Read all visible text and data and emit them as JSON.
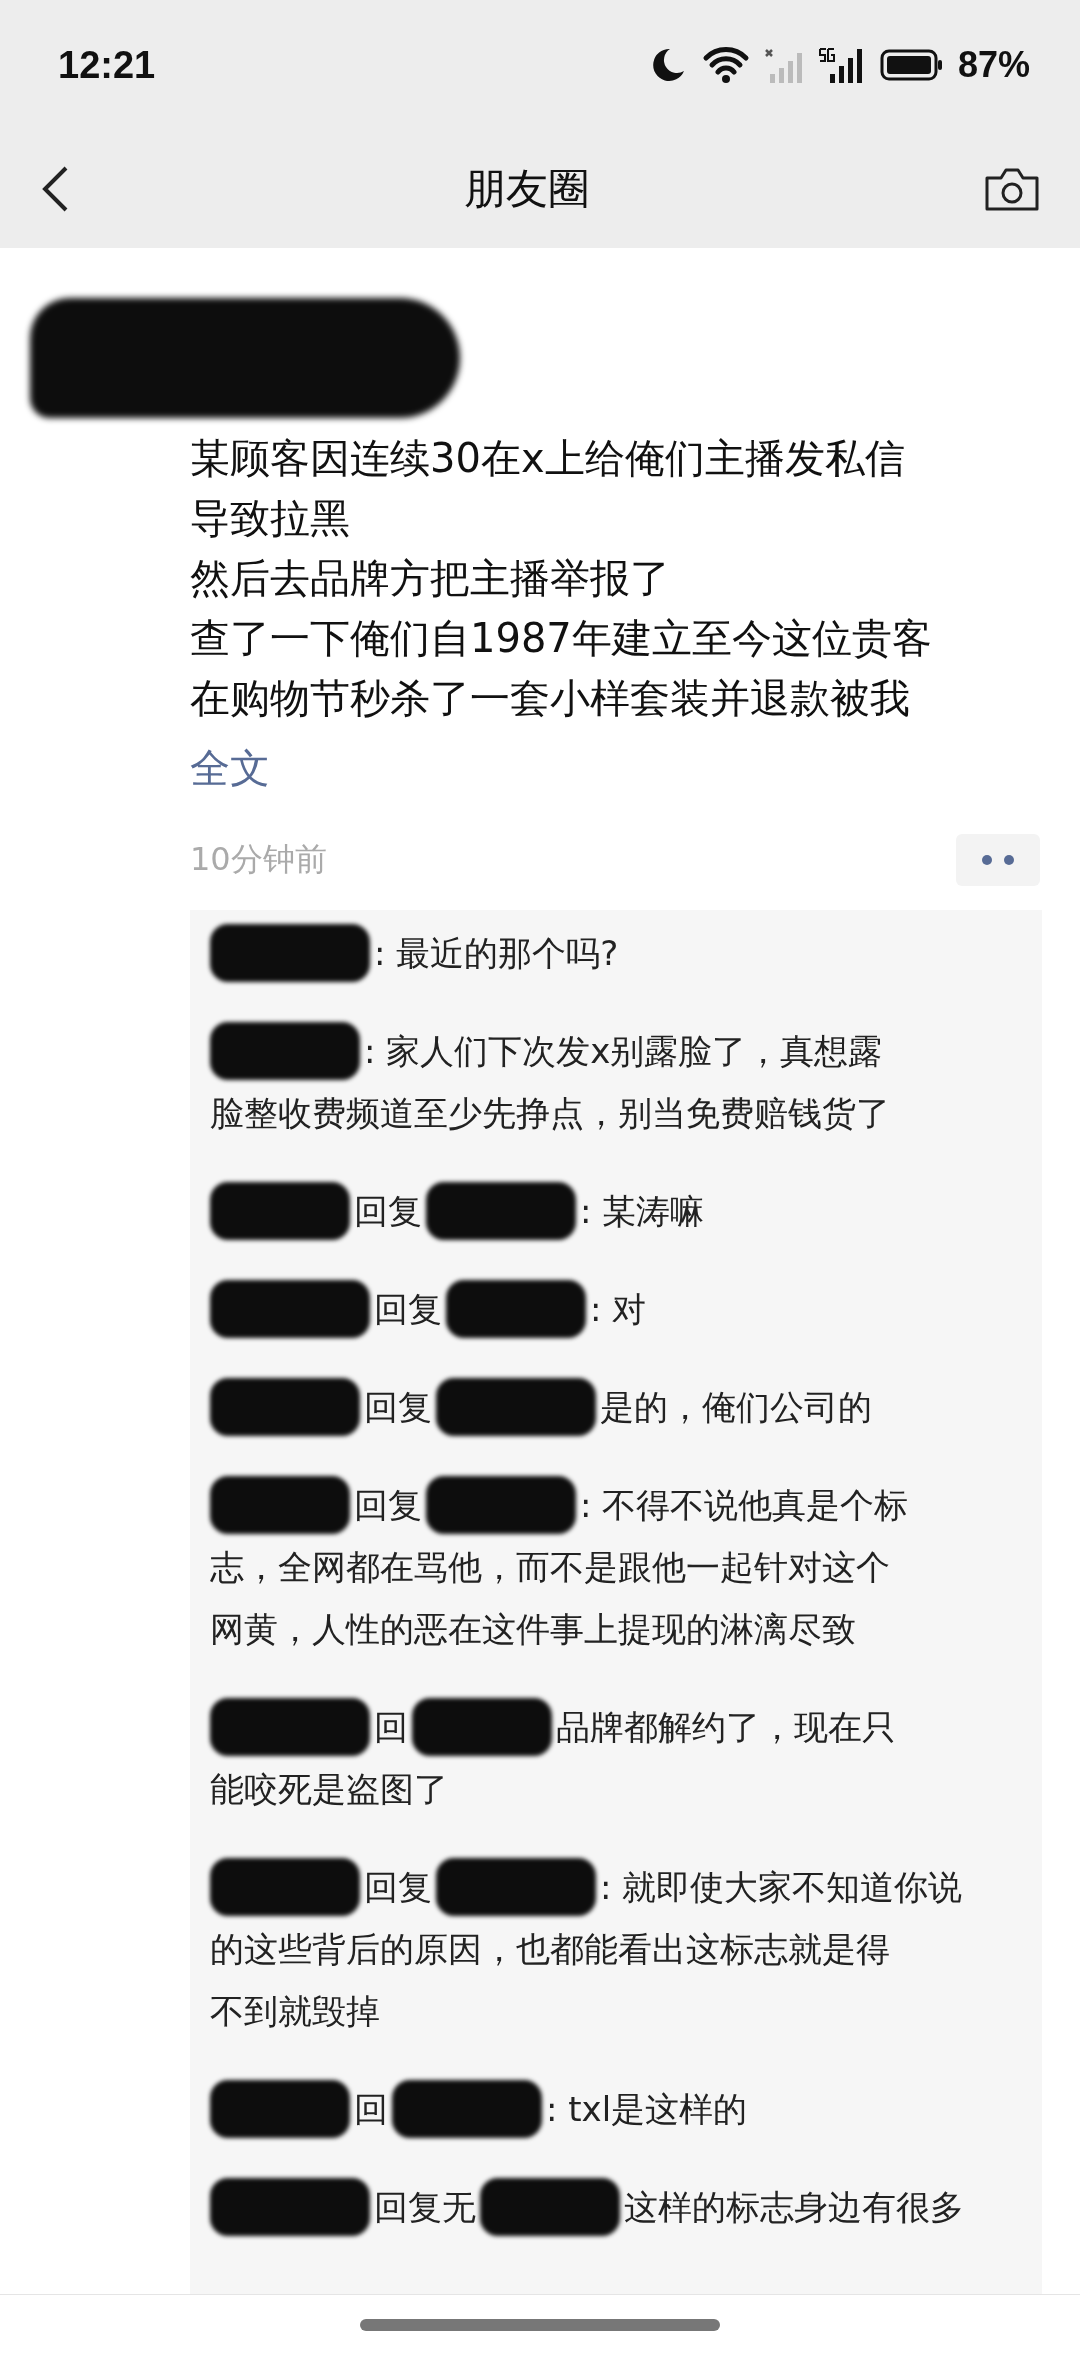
{
  "status_bar": {
    "time": "12:21",
    "battery": "87%"
  },
  "nav": {
    "title": "朋友圈"
  },
  "post": {
    "lines": [
      "某顾客因连续30在x上给俺们主播发私信",
      "导致拉黑",
      "然后去品牌方把主播举报了",
      "查了一下俺们自1987年建立至今这位贵客",
      "在购物节秒杀了一套小样套装并退款被我"
    ],
    "expand_link": "全文",
    "time": "10分钟前"
  },
  "comments": [
    {
      "parts": [
        {
          "kind": "redaction"
        },
        {
          "kind": "text",
          "text": ": 最近的那个吗?"
        }
      ]
    },
    {
      "parts": [
        {
          "kind": "redaction"
        },
        {
          "kind": "text",
          "text": ": 家人们下次发x别露脸了，真想露"
        }
      ],
      "more_lines": [
        "脸整收费频道至少先挣点，别当免费赔钱货了"
      ]
    },
    {
      "parts": [
        {
          "kind": "redaction"
        },
        {
          "kind": "text",
          "text": "回复"
        },
        {
          "kind": "redaction"
        },
        {
          "kind": "text",
          "text": ": 某涛嘛"
        }
      ]
    },
    {
      "parts": [
        {
          "kind": "redaction"
        },
        {
          "kind": "text",
          "text": "回复"
        },
        {
          "kind": "redaction"
        },
        {
          "kind": "text",
          "text": ": 对"
        }
      ]
    },
    {
      "parts": [
        {
          "kind": "redaction"
        },
        {
          "kind": "text",
          "text": "回复"
        },
        {
          "kind": "redaction"
        },
        {
          "kind": "text",
          "text": "是的，俺们公司的"
        }
      ]
    },
    {
      "parts": [
        {
          "kind": "redaction"
        },
        {
          "kind": "text",
          "text": "回复"
        },
        {
          "kind": "redaction"
        },
        {
          "kind": "text",
          "text": ": 不得不说他真是个标"
        }
      ],
      "more_lines": [
        "志，全网都在骂他，而不是跟他一起针对这个",
        "网黄，人性的恶在这件事上提现的淋漓尽致"
      ]
    },
    {
      "parts": [
        {
          "kind": "redaction"
        },
        {
          "kind": "text",
          "text": "回"
        },
        {
          "kind": "redaction"
        },
        {
          "kind": "text",
          "text": "品牌都解约了，现在只"
        }
      ],
      "more_lines": [
        "能咬死是盗图了"
      ]
    },
    {
      "parts": [
        {
          "kind": "redaction"
        },
        {
          "kind": "text",
          "text": "回复"
        },
        {
          "kind": "redaction"
        },
        {
          "kind": "text",
          "text": ": 就即使大家不知道你说"
        }
      ],
      "more_lines": [
        "的这些背后的原因，也都能看出这标志就是得",
        "不到就毁掉"
      ]
    },
    {
      "parts": [
        {
          "kind": "redaction"
        },
        {
          "kind": "text",
          "text": "回"
        },
        {
          "kind": "redaction"
        },
        {
          "kind": "text",
          "text": ": txl是这样的"
        }
      ]
    },
    {
      "parts": [
        {
          "kind": "redaction"
        },
        {
          "kind": "text",
          "text": "回复无"
        },
        {
          "kind": "redaction"
        },
        {
          "kind": "text",
          "text": "这样的标志身边有很多"
        }
      ]
    }
  ]
}
